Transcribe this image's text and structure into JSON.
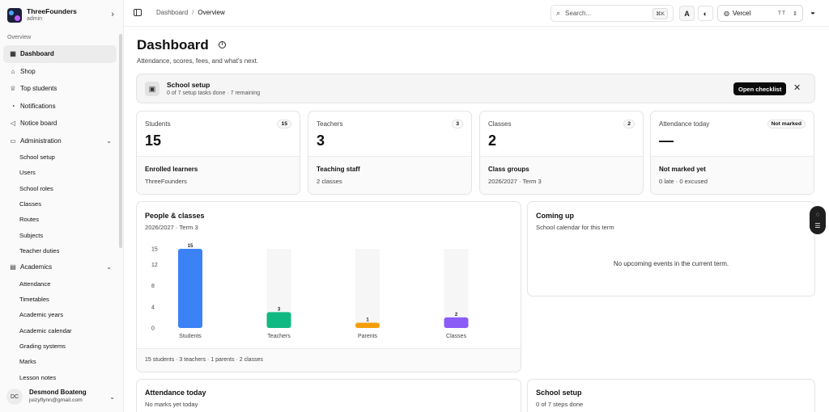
{
  "brand": {
    "name": "ThreeFounders",
    "role": "admin"
  },
  "sidebar": {
    "section": "Overview",
    "items": [
      {
        "label": "Dashboard",
        "icon": "grid-icon",
        "glyph": "▦"
      },
      {
        "label": "Shop",
        "icon": "store-icon",
        "glyph": "⌂"
      },
      {
        "label": "Top students",
        "icon": "trophy-icon",
        "glyph": "♕"
      },
      {
        "label": "Notifications",
        "icon": "bell-icon",
        "glyph": "◔"
      },
      {
        "label": "Notice board",
        "icon": "megaphone-icon",
        "glyph": "◁"
      },
      {
        "label": "Administration",
        "icon": "folder-icon",
        "glyph": "▭"
      }
    ],
    "administration": [
      "School setup",
      "Users",
      "School roles",
      "Classes",
      "Routes",
      "Subjects",
      "Teacher duties"
    ],
    "academics_label": "Academics",
    "academics": [
      "Attendance",
      "Timetables",
      "Academic years",
      "Academic calendar",
      "Grading systems",
      "Marks",
      "Lesson notes"
    ]
  },
  "user": {
    "initials": "DC",
    "name": "Desmond Boateng",
    "email": "juizyflynn@gmail.com"
  },
  "topbar": {
    "crumb_root": "Dashboard",
    "crumb_current": "Overview",
    "search_placeholder": "Search...",
    "search_shortcut": "⌘K",
    "team": "Vercel",
    "team_tag": "TT"
  },
  "page": {
    "title": "Dashboard",
    "subtitle": "Attendance, scores, fees, and what's next."
  },
  "setup_banner": {
    "title": "School setup",
    "progress": "0 of 7 setup tasks done · 7 remaining",
    "button": "Open checklist"
  },
  "stats": [
    {
      "label": "Students",
      "badge": "15",
      "value": "15",
      "foot_title": "Enrolled learners",
      "foot_sub": "ThreeFounders"
    },
    {
      "label": "Teachers",
      "badge": "3",
      "value": "3",
      "foot_title": "Teaching staff",
      "foot_sub": "2 classes"
    },
    {
      "label": "Classes",
      "badge": "2",
      "value": "2",
      "foot_title": "Class groups",
      "foot_sub": "2026/2027 · Term 3"
    },
    {
      "label": "Attendance today",
      "badge": "Not marked",
      "value": "—",
      "foot_title": "Not marked yet",
      "foot_sub": "0 late · 0 excused"
    }
  ],
  "people_card": {
    "title": "People & classes",
    "sub": "2026/2027 · Term 3",
    "footer": "15 students · 3 teachers · 1 parents · 2 classes"
  },
  "chart_data": {
    "type": "bar",
    "categories": [
      "Students",
      "Teachers",
      "Parents",
      "Classes"
    ],
    "values": [
      15,
      3,
      1,
      2
    ],
    "colors": [
      "#3b82f6",
      "#10b981",
      "#f59e0b",
      "#8b5cf6"
    ],
    "yticks": [
      0,
      4,
      8,
      12,
      15
    ],
    "ylim": [
      0,
      15
    ],
    "grid": false,
    "legend": "none"
  },
  "coming_up": {
    "title": "Coming up",
    "sub": "School calendar for this term",
    "empty": "No upcoming events in the current term."
  },
  "attendance_card": {
    "title": "Attendance today",
    "sub": "No marks yet today"
  },
  "setup_card": {
    "title": "School setup",
    "sub": "0 of 7 steps done"
  }
}
